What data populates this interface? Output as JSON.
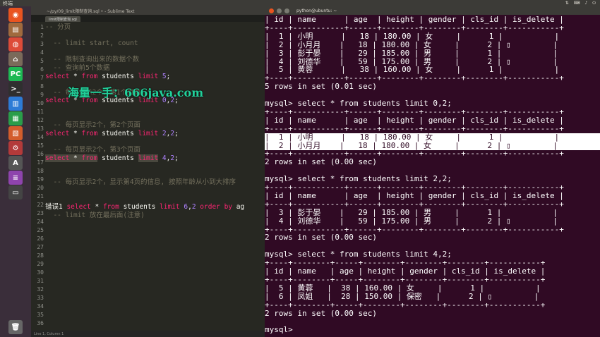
{
  "topbar": {
    "title": "终端"
  },
  "launcher": {
    "icons": [
      {
        "name": "ubuntu-dash-icon",
        "glyph": "◉",
        "color": "#e95420"
      },
      {
        "name": "files-icon",
        "glyph": "▤",
        "color": "#a06a3e"
      },
      {
        "name": "chrome-icon",
        "glyph": "◍",
        "color": "#dd4b39"
      },
      {
        "name": "home-folder-icon",
        "glyph": "⌂",
        "color": "#7a6a5a"
      },
      {
        "name": "pycharm-icon",
        "glyph": "PC",
        "color": "#1db954"
      },
      {
        "name": "terminal-icon",
        "glyph": ">_",
        "color": "#2f2f2f"
      },
      {
        "name": "document-icon",
        "glyph": "▥",
        "color": "#2d7bd6"
      },
      {
        "name": "spreadsheet-icon",
        "glyph": "▦",
        "color": "#2a9d4a"
      },
      {
        "name": "presentation-icon",
        "glyph": "▧",
        "color": "#d35d2c"
      },
      {
        "name": "settings-icon",
        "glyph": "⚙",
        "color": "#b33a3a"
      },
      {
        "name": "sublime-icon",
        "glyph": "A",
        "color": "#555"
      },
      {
        "name": "purple-app-icon",
        "glyph": "≡",
        "color": "#8e44ad"
      },
      {
        "name": "monitor-icon",
        "glyph": "▭",
        "color": "#444"
      }
    ],
    "trash": {
      "name": "trash-icon",
      "glyph": "🗑",
      "color": "#666"
    }
  },
  "editor": {
    "title": "~/py/09_limit限制查询.sql • - Sublime Text",
    "tab": "limit限制查询.sql",
    "status": "Line 1, Column 1",
    "line_numbers": [
      "1",
      "2",
      "3",
      "4",
      "5",
      "6",
      "7",
      "8",
      "9",
      "10",
      "11",
      "12",
      "13",
      "14",
      "15",
      "16",
      "17",
      "18",
      "19",
      "20",
      "21",
      "22",
      "23",
      "24",
      "25",
      "26",
      "27",
      "28",
      "29",
      "30",
      "31",
      "32",
      "33",
      "34",
      "35",
      "36"
    ],
    "lines": [
      {
        "spans": [
          {
            "c": "cm",
            "t": "-- 分页"
          }
        ]
      },
      {
        "spans": []
      },
      {
        "spans": [
          {
            "c": "cm",
            "t": "  -- limit start, count"
          }
        ]
      },
      {
        "spans": []
      },
      {
        "spans": [
          {
            "c": "cm",
            "t": "  -- 限制查询出来的数据个数"
          }
        ]
      },
      {
        "spans": [
          {
            "c": "cm",
            "t": "  -- 查询前5个数据"
          }
        ]
      },
      {
        "spans": [
          {
            "c": "kw",
            "t": "select"
          },
          {
            "c": "pl",
            "t": " * "
          },
          {
            "c": "kw",
            "t": "from"
          },
          {
            "c": "pl",
            "t": " students "
          },
          {
            "c": "kw",
            "t": "limit"
          },
          {
            "c": "nu",
            "t": " 5"
          },
          {
            "c": "pl",
            "t": ";"
          }
        ]
      },
      {
        "spans": []
      },
      {
        "spans": [
          {
            "c": "cm",
            "t": "  -- 每页显示2个，第1个页面"
          }
        ]
      },
      {
        "spans": [
          {
            "c": "kw",
            "t": "select"
          },
          {
            "c": "pl",
            "t": " * "
          },
          {
            "c": "kw",
            "t": "from"
          },
          {
            "c": "pl",
            "t": " students "
          },
          {
            "c": "kw",
            "t": "limit"
          },
          {
            "c": "nu",
            "t": " 0"
          },
          {
            "c": "pl",
            "t": ","
          },
          {
            "c": "nu",
            "t": "2"
          },
          {
            "c": "pl",
            "t": ";"
          }
        ]
      },
      {
        "spans": []
      },
      {
        "spans": []
      },
      {
        "spans": [
          {
            "c": "cm",
            "t": "  -- 每页显示2个，第2个页面"
          }
        ]
      },
      {
        "spans": [
          {
            "c": "kw",
            "t": "select"
          },
          {
            "c": "pl",
            "t": " * "
          },
          {
            "c": "kw",
            "t": "from"
          },
          {
            "c": "pl",
            "t": " students "
          },
          {
            "c": "kw",
            "t": "limit"
          },
          {
            "c": "nu",
            "t": " 2"
          },
          {
            "c": "pl",
            "t": ","
          },
          {
            "c": "nu",
            "t": "2"
          },
          {
            "c": "pl",
            "t": ";"
          }
        ]
      },
      {
        "spans": []
      },
      {
        "spans": [
          {
            "c": "cm",
            "t": "  -- 每页显示2个，第3个页面"
          }
        ]
      },
      {
        "spans": [
          {
            "c": "kw sel",
            "t": "select"
          },
          {
            "c": "pl sel",
            "t": " * "
          },
          {
            "c": "kw sel",
            "t": "from"
          },
          {
            "c": "pl",
            "t": " students "
          },
          {
            "c": "kw sel",
            "t": "limit"
          },
          {
            "c": "nu",
            "t": " 4"
          },
          {
            "c": "pl",
            "t": ","
          },
          {
            "c": "nu",
            "t": "2"
          },
          {
            "c": "pl",
            "t": ";"
          }
        ]
      },
      {
        "spans": []
      },
      {
        "spans": []
      },
      {
        "spans": [
          {
            "c": "cm",
            "t": "  -- 每页显示2个，显示第4页的信息, 按照年龄从小到大排序"
          }
        ]
      },
      {
        "spans": []
      },
      {
        "spans": []
      },
      {
        "spans": [
          {
            "c": "pl",
            "t": "错误1 "
          },
          {
            "c": "kw",
            "t": "select"
          },
          {
            "c": "pl",
            "t": " * "
          },
          {
            "c": "kw",
            "t": "from"
          },
          {
            "c": "pl",
            "t": " students "
          },
          {
            "c": "kw",
            "t": "limit"
          },
          {
            "c": "nu",
            "t": " 6"
          },
          {
            "c": "pl",
            "t": ","
          },
          {
            "c": "nu",
            "t": "2"
          },
          {
            "c": "kw",
            "t": " order by"
          },
          {
            "c": "pl",
            "t": " ag"
          }
        ]
      },
      {
        "spans": [
          {
            "c": "cm",
            "t": "  -- limit 放在最后面(注意)"
          }
        ]
      }
    ]
  },
  "watermark": "海量一手：666java.com",
  "terminal": {
    "title": "python@ubuntu: ~",
    "lines": [
      "| id | name      | age  | height | gender | cls_id | is_delete |",
      "+----+-----------+------+--------+--------+--------+-----------+",
      "|  1 | 小明      |   18 | 180.00 | 女     |      1 |           |",
      "|  2 | 小月月    |   18 | 180.00 | 女     |      2 | \u0001         |",
      "|  3 | 彭于晏    |   29 | 185.00 | 男     |      1 |           |",
      "|  4 | 刘德华    |   59 | 175.00 | 男     |      2 | \u0001         |",
      "|  5 | 黄蓉      |   38 | 160.00 | 女     |      1 |           |",
      "+----+-----------+------+--------+--------+--------+-----------+",
      "5 rows in set (0.01 sec)",
      "",
      "mysql> select * from students limit 0,2;",
      "+----+-----------+------+--------+--------+--------+-----------+",
      "| id | name      | age  | height | gender | cls_id | is_delete |",
      "+----+-----------+------+--------+--------+--------+-----------+",
      "|  1 | 小明      |   18 | 180.00 | 女     |      1 |           |",
      "|  2 | 小月月    |   18 | 180.00 | 女     |      2 | \u0001         |",
      "+----+-----------+------+--------+--------+--------+-----------+",
      "2 rows in set (0.00 sec)",
      "",
      "mysql> select * from students limit 2,2;",
      "+----+-----------+------+--------+--------+--------+-----------+",
      "| id | name      | age  | height | gender | cls_id | is_delete |",
      "+----+-----------+------+--------+--------+--------+-----------+",
      "|  3 | 彭于晏    |   29 | 185.00 | 男     |      1 |           |",
      "|  4 | 刘德华    |   59 | 175.00 | 男     |      2 | \u0001         |",
      "+----+-----------+------+--------+--------+--------+-----------+",
      "2 rows in set (0.00 sec)",
      "",
      "mysql> select * from students limit 4,2;",
      "+----+--------+-----+--------+--------+--------+-----------+",
      "| id | name   | age | height | gender | cls_id | is_delete |",
      "+----+--------+-----+--------+--------+--------+-----------+",
      "|  5 | 黄蓉   |  38 | 160.00 | 女     |      1 |           |",
      "|  6 | 凤姐   |  28 | 150.00 | 保密   |      2 | \u0001         |",
      "+----+--------+-----+--------+--------+--------+-----------+",
      "2 rows in set (0.00 sec)",
      "",
      "mysql> "
    ],
    "highlight_lines": [
      14,
      15
    ]
  }
}
